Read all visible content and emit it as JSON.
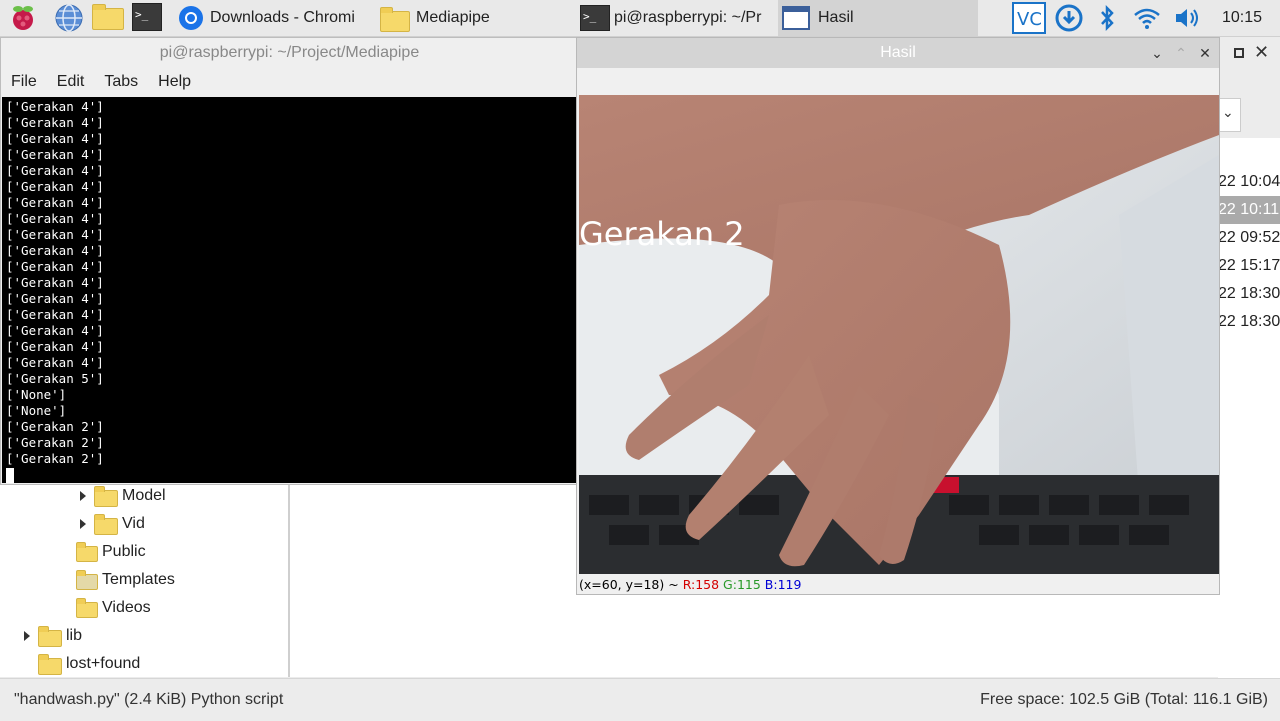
{
  "taskbar": {
    "tasks": [
      {
        "label": "Downloads - Chromi",
        "icon": "chromium-icon"
      },
      {
        "label": "Mediapipe",
        "icon": "folder-icon"
      },
      {
        "label": "pi@raspberrypi: ~/Pr",
        "icon": "terminal-icon"
      },
      {
        "label": "Hasil",
        "icon": "window-icon"
      }
    ],
    "clock": "10:15"
  },
  "terminal": {
    "title": "pi@raspberrypi: ~/Project/Mediapipe",
    "menu": [
      "File",
      "Edit",
      "Tabs",
      "Help"
    ],
    "lines": [
      "['Gerakan 4']",
      "['Gerakan 4']",
      "['Gerakan 4']",
      "['Gerakan 4']",
      "['Gerakan 4']",
      "['Gerakan 4']",
      "['Gerakan 4']",
      "['Gerakan 4']",
      "['Gerakan 4']",
      "['Gerakan 4']",
      "['Gerakan 4']",
      "['Gerakan 4']",
      "['Gerakan 4']",
      "['Gerakan 4']",
      "['Gerakan 4']",
      "['Gerakan 4']",
      "['Gerakan 4']",
      "['Gerakan 5']",
      "['None']",
      "['None']",
      "['Gerakan 2']",
      "['Gerakan 2']",
      "['Gerakan 2']"
    ]
  },
  "filetree": {
    "items": [
      {
        "label": "Model",
        "expandable": true
      },
      {
        "label": "Vid",
        "expandable": true
      },
      {
        "label": "Public",
        "expandable": false
      },
      {
        "label": "Templates",
        "expandable": false
      },
      {
        "label": "Videos",
        "expandable": false
      },
      {
        "label": "lib",
        "expandable": true
      },
      {
        "label": "lost+found",
        "expandable": false
      }
    ]
  },
  "background_list": {
    "dates": [
      "22 10:04",
      "22 10:11",
      "22 09:52",
      "22 15:17",
      "22 18:30",
      "22 18:30"
    ],
    "selected_index": 1
  },
  "hasil": {
    "title": "Hasil",
    "overlay_text": "Gerakan 2",
    "status": {
      "coords": "(x=60, y=18) ~",
      "r": "R:158",
      "g": "G:115",
      "b": "B:119"
    }
  },
  "statusbar": {
    "left": "\"handwash.py\" (2.4 KiB) Python script",
    "right": "Free space: 102.5 GiB (Total: 116.1 GiB)"
  },
  "colors": {
    "terminal_bg": "#000000",
    "status_r": "#d40000",
    "status_g": "#2a9a2a",
    "status_b": "#0000d4",
    "vscode_blue": "#1a73c8"
  }
}
